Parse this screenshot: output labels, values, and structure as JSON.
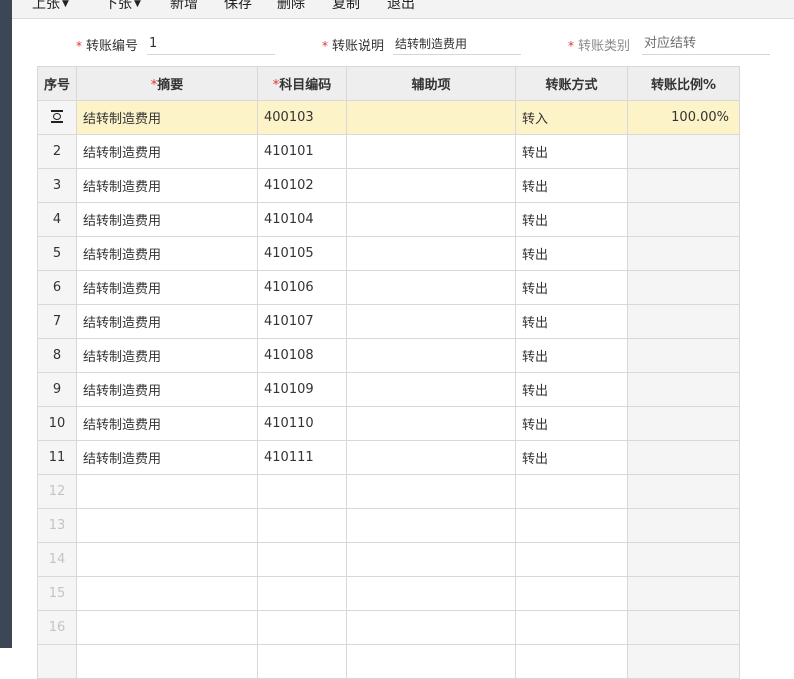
{
  "toolbar": {
    "prev_label": "上张",
    "next_label": "下张",
    "add_label": "新增",
    "save_label": "保存",
    "delete_label": "删除",
    "copy_label": "复制",
    "exit_label": "退出"
  },
  "form": {
    "transfer_no": {
      "label": "转账编号",
      "value": "1"
    },
    "transfer_desc": {
      "label": "转账说明",
      "value": "结转制造费用"
    },
    "transfer_type": {
      "label": "转账类别",
      "value": "对应结转"
    }
  },
  "table": {
    "headers": {
      "seq": "序号",
      "summary": "摘要",
      "account": "科目编码",
      "aux": "辅助项",
      "method": "转账方式",
      "ratio": "转账比例%"
    },
    "rows": [
      {
        "seq": "",
        "summary": "结转制造费用",
        "account": "400103",
        "aux": "",
        "method": "转入",
        "ratio": "100.00%"
      },
      {
        "seq": "2",
        "summary": "结转制造费用",
        "account": "410101",
        "aux": "",
        "method": "转出",
        "ratio": ""
      },
      {
        "seq": "3",
        "summary": "结转制造费用",
        "account": "410102",
        "aux": "",
        "method": "转出",
        "ratio": ""
      },
      {
        "seq": "4",
        "summary": "结转制造费用",
        "account": "410104",
        "aux": "",
        "method": "转出",
        "ratio": ""
      },
      {
        "seq": "5",
        "summary": "结转制造费用",
        "account": "410105",
        "aux": "",
        "method": "转出",
        "ratio": ""
      },
      {
        "seq": "6",
        "summary": "结转制造费用",
        "account": "410106",
        "aux": "",
        "method": "转出",
        "ratio": ""
      },
      {
        "seq": "7",
        "summary": "结转制造费用",
        "account": "410107",
        "aux": "",
        "method": "转出",
        "ratio": ""
      },
      {
        "seq": "8",
        "summary": "结转制造费用",
        "account": "410108",
        "aux": "",
        "method": "转出",
        "ratio": ""
      },
      {
        "seq": "9",
        "summary": "结转制造费用",
        "account": "410109",
        "aux": "",
        "method": "转出",
        "ratio": ""
      },
      {
        "seq": "10",
        "summary": "结转制造费用",
        "account": "410110",
        "aux": "",
        "method": "转出",
        "ratio": ""
      },
      {
        "seq": "11",
        "summary": "结转制造费用",
        "account": "410111",
        "aux": "",
        "method": "转出",
        "ratio": ""
      },
      {
        "seq": "12",
        "summary": "",
        "account": "",
        "aux": "",
        "method": "",
        "ratio": ""
      },
      {
        "seq": "13",
        "summary": "",
        "account": "",
        "aux": "",
        "method": "",
        "ratio": ""
      },
      {
        "seq": "14",
        "summary": "",
        "account": "",
        "aux": "",
        "method": "",
        "ratio": ""
      },
      {
        "seq": "15",
        "summary": "",
        "account": "",
        "aux": "",
        "method": "",
        "ratio": ""
      },
      {
        "seq": "16",
        "summary": "",
        "account": "",
        "aux": "",
        "method": "",
        "ratio": ""
      },
      {
        "seq": "",
        "summary": "",
        "account": "",
        "aux": "",
        "method": "",
        "ratio": ""
      }
    ]
  },
  "icons": {
    "selected_row_indicator": "current-row-icon"
  },
  "colors": {
    "selected_row": "#fcf3c8",
    "required_star": "#e5342b",
    "header_bg": "#eeeeee"
  }
}
